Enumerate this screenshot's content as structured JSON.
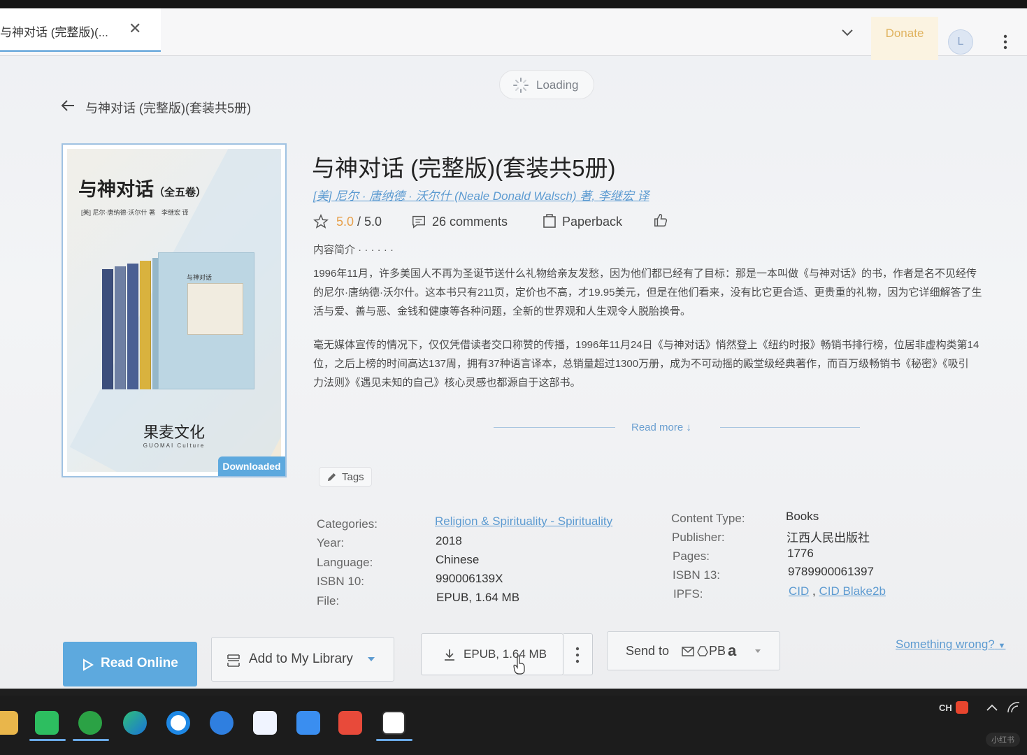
{
  "tab": {
    "title": "与神对话 (完整版)(...",
    "close_label": "✕"
  },
  "header": {
    "donate_label": "Donate",
    "avatar_letter": "L",
    "loading_label": "Loading"
  },
  "breadcrumb": {
    "title": "与神对话 (完整版)(套装共5册)"
  },
  "cover": {
    "title": "与神对话",
    "title_suffix": "（全五卷）",
    "authors_line": "[美] 尼尔·唐纳德·沃尔什 著　李继宏 译",
    "publisher_cn": "果麦文化",
    "publisher_en": "GUOMAI Culture",
    "downloaded_label": "Downloaded",
    "front_book_label": "与神对话",
    "colors": [
      "#3c4e7c",
      "#6e7fa3",
      "#4a5f93",
      "#d9b23e",
      "#95b7c9"
    ]
  },
  "book": {
    "title": "与神对话 (完整版)(套装共5册)",
    "authors": "[美] 尼尔 · 唐纳德 · 沃尔什 (Neale Donald Walsch) 著",
    "translator": "李继宏 译",
    "rating": "5.0",
    "rating_max": "/ 5.0",
    "comments": "26 comments",
    "format": "Paperback",
    "intro_label": "内容简介 · · · · · ·",
    "desc_p1_l1": "1996年11月，许多美国人不再为圣诞节送什么礼物给亲友发愁，因为他们都已经有了目标：那是一本叫做《与神对话》的书，作者是名不见经传",
    "desc_p1_l2": "的尼尔·唐纳德·沃尔什。这本书只有211页，定价也不高，才19.95美元，但是在他们看来，没有比它更合适、更贵重的礼物，因为它详细解答了生",
    "desc_p1_l3": "活与爱、善与恶、金钱和健康等各种问题，全新的世界观和人生观令人脱胎换骨。",
    "desc_p2_l1": "毫无媒体宣传的情况下，仅仅凭借读者交口称赞的传播，1996年11月24日《与神对话》悄然登上《纽约时报》畅销书排行榜，位居非虚构类第14",
    "desc_p2_l2": "位，之后上榜的时间高达137周，拥有37种语言译本，总销量超过1300万册，成为不可动摇的殿堂级经典著作，而百万级畅销书《秘密》《吸引",
    "desc_p2_l3": "力法则》《遇见未知的自己》核心灵感也都源自于这部书。",
    "read_more": "Read more",
    "tags_label": "Tags"
  },
  "details": {
    "categories_label": "Categories:",
    "categories_value": "Religion & Spirituality - Spirituality",
    "year_label": "Year:",
    "year_value": "2018",
    "language_label": "Language:",
    "language_value": "Chinese",
    "isbn10_label": "ISBN 10:",
    "isbn10_value": "990006139X",
    "file_label": "File:",
    "file_value": "EPUB, 1.64 MB",
    "content_type_label": "Content Type:",
    "content_type_value": "Books",
    "publisher_label": "Publisher:",
    "publisher_value": "江西人民出版社",
    "pages_label": "Pages:",
    "pages_value": "1776",
    "isbn13_label": "ISBN 13:",
    "isbn13_value": "9789900061397",
    "ipfs_label": "IPFS:",
    "ipfs_cid": "CID",
    "ipfs_sep": ",",
    "ipfs_cid_blake": "CID Blake2b"
  },
  "actions": {
    "read_online": "Read Online",
    "add_library": "Add to My Library",
    "download": "EPUB, 1.64 MB",
    "send_to": "Send to",
    "send_targets": "PB",
    "send_amazon": "a",
    "something_wrong": "Something wrong?"
  },
  "taskbar": {
    "lang": "CH",
    "watermark": "小红书",
    "icons": [
      "folder-icon",
      "wechat-icon",
      "wechat-work-icon",
      "edge-icon",
      "search-app-icon",
      "kugou-icon",
      "baidu-netdisk-icon",
      "feishu-icon",
      "netease-music-icon",
      "vim-icon"
    ]
  },
  "colors": {
    "accent": "#5da9de",
    "donate": "#e0b25e",
    "link": "#5d9bd1",
    "rating": "#e7a04b"
  }
}
